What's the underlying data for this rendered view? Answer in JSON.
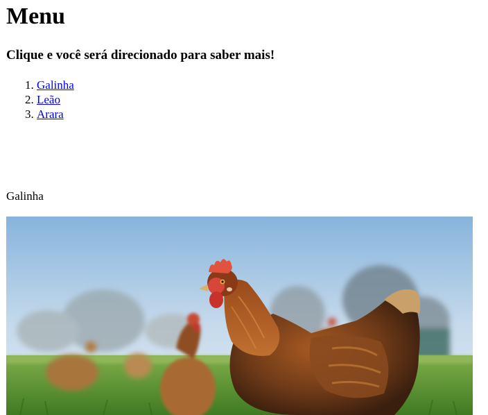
{
  "page": {
    "title": "Menu",
    "subtitle": "Clique e você será direcionado para saber mais!"
  },
  "menu": {
    "items": [
      {
        "label": "Galinha"
      },
      {
        "label": "Leão"
      },
      {
        "label": "Arara"
      }
    ]
  },
  "section": {
    "label": "Galinha",
    "image_subject": "chicken-photo"
  },
  "colors": {
    "link": "#0000ee",
    "text": "#000000",
    "background": "#ffffff"
  }
}
